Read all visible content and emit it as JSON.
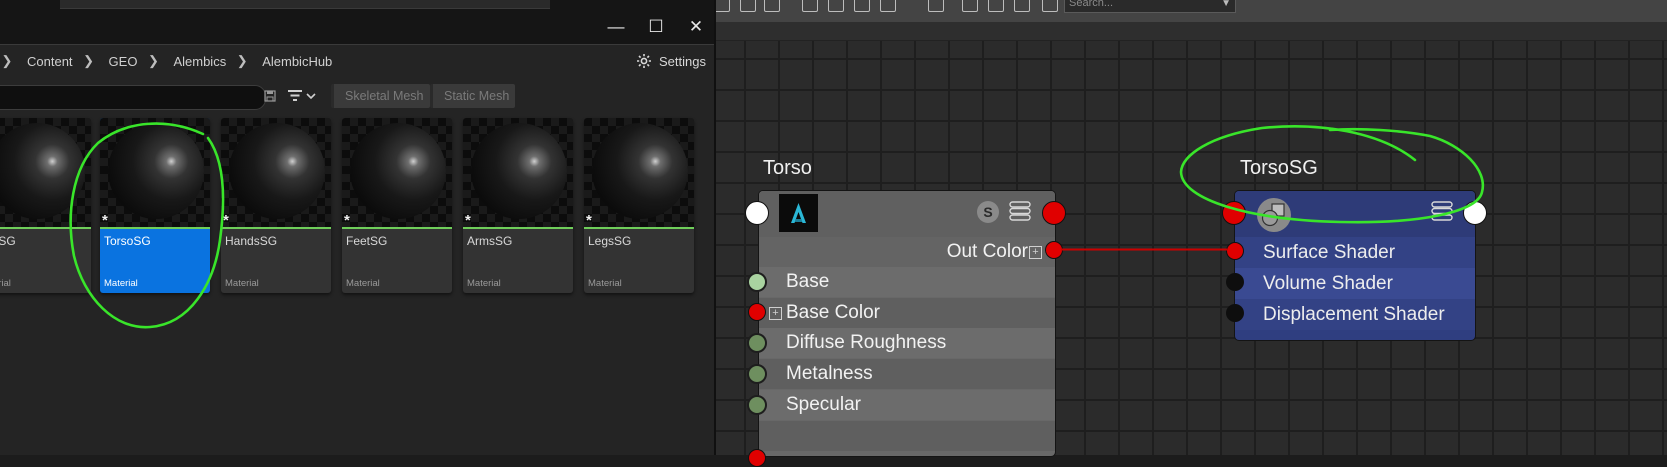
{
  "unreal": {
    "window_controls": {
      "minimize": "—",
      "maximize": "☐",
      "close": "✕"
    },
    "breadcrumb": [
      "Content",
      "GEO",
      "Alembics",
      "AlembicHub"
    ],
    "settings_label": "Settings",
    "search": {
      "value": "",
      "placeholder": ""
    },
    "filter_chips": [
      "Skeletal Mesh",
      "Static Mesh"
    ],
    "assets": [
      {
        "name": "HeadSG",
        "type": "Material",
        "selected": false
      },
      {
        "name": "TorsoSG",
        "type": "Material",
        "selected": true
      },
      {
        "name": "HandsSG",
        "type": "Material",
        "selected": false
      },
      {
        "name": "FeetSG",
        "type": "Material",
        "selected": false
      },
      {
        "name": "ArmsSG",
        "type": "Material",
        "selected": false
      },
      {
        "name": "LegsSG",
        "type": "Material",
        "selected": false
      }
    ],
    "visible_asset_labels": [
      "adSG",
      "aterial"
    ],
    "unsaved_marker": "*"
  },
  "maya": {
    "search": {
      "placeholder": "Search..."
    },
    "nodes": {
      "torso": {
        "title": "Torso",
        "output": "Out Color",
        "s_badge": "S",
        "inputs": [
          "Base",
          "Base Color",
          "Diffuse Roughness",
          "Metalness",
          "Specular"
        ]
      },
      "torso_sg": {
        "title": "TorsoSG",
        "inputs": [
          "Surface Shader",
          "Volume Shader",
          "Displacement Shader"
        ]
      }
    },
    "connection": {
      "from": "Torso.Out Color",
      "to": "TorsoSG.Surface Shader",
      "color": "#cc0000"
    }
  },
  "colors": {
    "selection_blue": "#0a73e0",
    "annotation_green": "#39e52a",
    "port_red": "#e00000",
    "shading_group_blue": "#2f3e80"
  }
}
